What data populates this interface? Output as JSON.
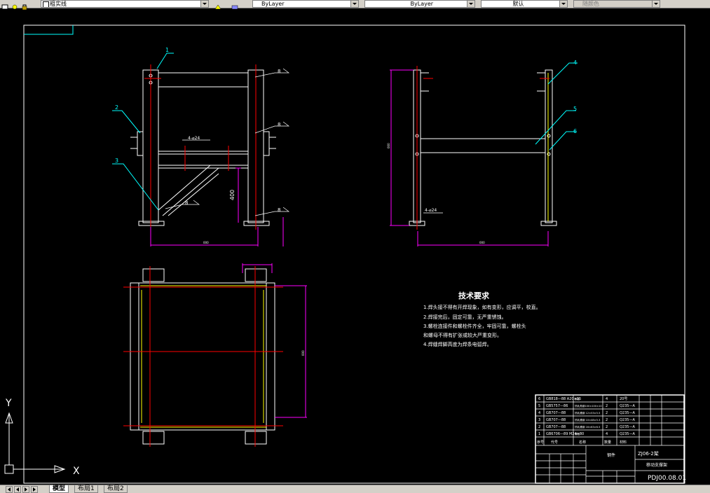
{
  "toolbar": {
    "layer_combo": "粗实线",
    "color_combo": "ByLayer",
    "linetype_combo": "ByLayer",
    "lineweight_combo": "默认",
    "plotstyle_combo": "随颜色"
  },
  "tabs": {
    "model": "模型",
    "layout1": "布局1",
    "layout2": "布局2"
  },
  "ucs": {
    "x": "X",
    "y": "Y"
  },
  "drawing": {
    "balloons": [
      "1",
      "2",
      "3",
      "4",
      "5",
      "6"
    ],
    "hole_front": "4-⌀24",
    "hole_side": "4-⌀24",
    "dim_400": "400",
    "weld_mark": "8"
  },
  "tech": {
    "title": "技术要求",
    "items": [
      "1.焊头接不得有开焊现象，如有变形，应调平，校直。",
      "2.焊接完后，固定可靠，无严重锈蚀。",
      "3.螺栓连接件和螺栓件齐全，牢固可靠，螺栓头",
      "  和螺母不得有扩张或较大严重变形。",
      "4.焊缝焊脚高度为焊条电弧焊。"
    ]
  },
  "bom": {
    "rows": [
      [
        "6",
        "GB818—88 A20×35",
        "钢板",
        "4",
        "20号"
      ],
      [
        "5",
        "GB5757—86",
        "热轧角钢100×100×10",
        "2",
        "Q235—A"
      ],
      [
        "4",
        "GB707—88",
        "热轧槽钢 12×53×5.5",
        "2",
        "Q235—A"
      ],
      [
        "3",
        "GB707—88",
        "热轧槽钢 10×48×5.3",
        "2",
        "Q235—A"
      ],
      [
        "2",
        "GB707—88",
        "热轧槽钢 16×63×6.5",
        "2",
        "Q235—A"
      ],
      [
        "1",
        "GB6706—89 M24×80",
        "螺栓",
        "4",
        "Q235—A"
      ]
    ],
    "header": [
      "序号",
      "代号",
      "名称",
      "数量",
      "材料"
    ],
    "part_label": "钢件",
    "project": "ZJ06-2架",
    "title_name": "移动支撑架",
    "drawing_no": "PDJ00.08.01"
  }
}
